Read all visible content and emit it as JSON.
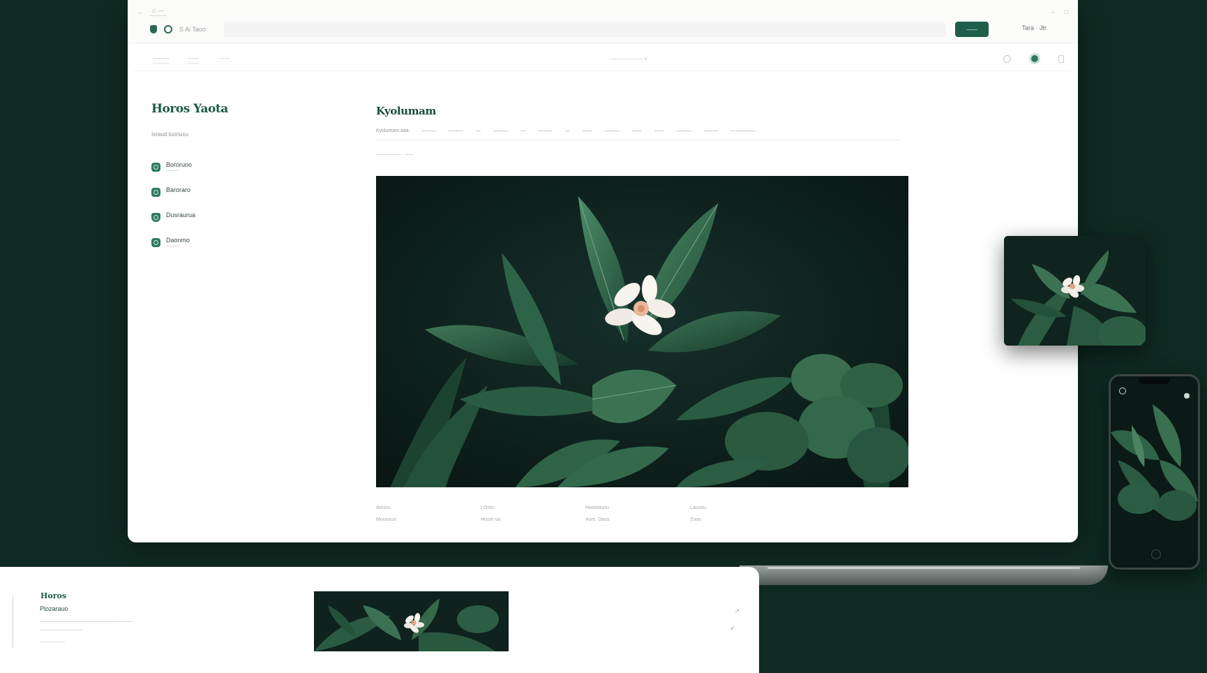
{
  "window": {
    "tab_label": "⌂ —",
    "nav_back": "←",
    "controls": [
      "–",
      "□"
    ],
    "address_text": "S Ai Taoo",
    "cta_label": "——",
    "top_right_text": "Tara · Jtr"
  },
  "subnav": {
    "links": [
      "———",
      "——",
      "- -----"
    ],
    "center_text": "—————— ˅"
  },
  "sidebar": {
    "brand": "Horos Yaota",
    "subtitle": "Ixraud Iuonuxu",
    "items": [
      {
        "label": "Bororuno",
        "sub": "———",
        "icon": "plant-icon"
      },
      {
        "label": "Baroraro",
        "sub": "",
        "icon": "leaf-icon"
      },
      {
        "label": "Dusraurua",
        "sub": "",
        "icon": "shield-icon"
      },
      {
        "label": "Daonmo",
        "sub": "———",
        "icon": "pot-icon"
      }
    ]
  },
  "main": {
    "title": "Kyolumam",
    "crumbs": [
      "Kyolumam aaa",
      "———",
      "———",
      "—",
      "———",
      "—",
      "———",
      "—",
      "——",
      "———",
      "——",
      "——",
      "———",
      "———",
      "—————"
    ],
    "meta": "——————  ·  ——"
  },
  "footer_table": {
    "rows": [
      [
        "Aorsru",
        "LOrxo",
        "Hosmounu",
        "Lauusu"
      ],
      [
        "Mounsuo",
        "Hoser ua",
        "Aors. Dous",
        "Zooo"
      ]
    ]
  },
  "banner": {
    "brand": "Horos",
    "title": "Plozarauo",
    "line1": "———————————————————   ———",
    "line2": "——————————",
    "line3": "——————"
  },
  "colors": {
    "background": "#0f2a22",
    "accent": "#1f5e4b",
    "brand_text": "#1d5a45"
  }
}
